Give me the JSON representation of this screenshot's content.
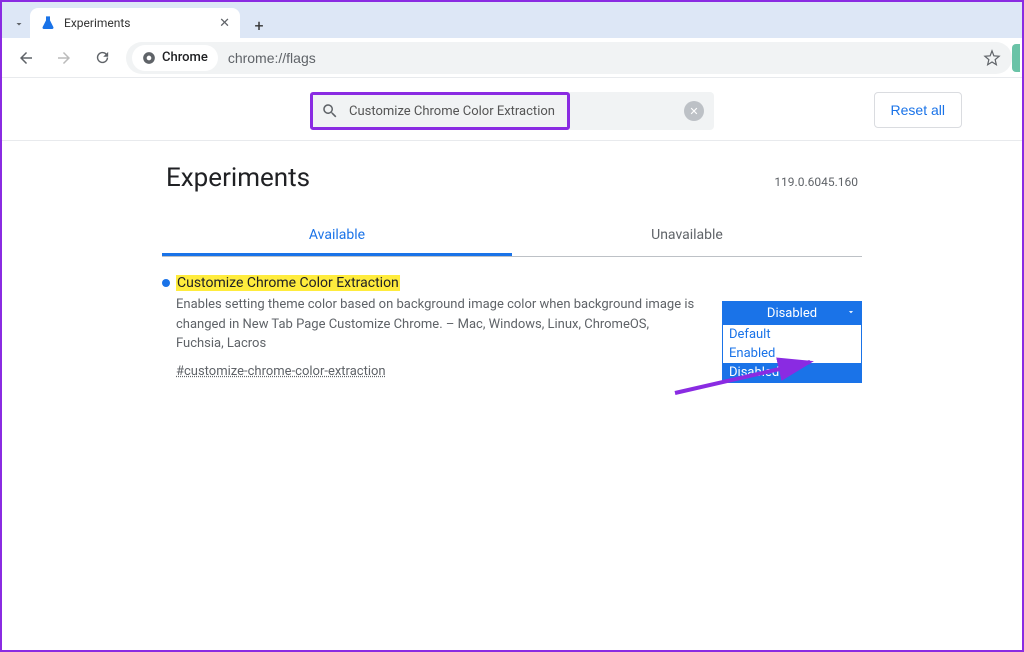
{
  "browser": {
    "tab_title": "Experiments",
    "omnibox_prefix_label": "Chrome",
    "omnibox_url": "chrome://flags"
  },
  "search": {
    "query": "Customize Chrome Color Extraction"
  },
  "buttons": {
    "reset_all": "Reset all"
  },
  "header": {
    "title": "Experiments",
    "version": "119.0.6045.160"
  },
  "tabs": {
    "available": "Available",
    "unavailable": "Unavailable"
  },
  "flag": {
    "title": "Customize Chrome Color Extraction",
    "description": "Enables setting theme color based on background image color when background image is changed in New Tab Page Customize Chrome. – Mac, Windows, Linux, ChromeOS, Fuchsia, Lacros",
    "anchor": "#customize-chrome-color-extraction",
    "selected": "Disabled",
    "options": [
      "Default",
      "Enabled",
      "Disabled"
    ]
  }
}
